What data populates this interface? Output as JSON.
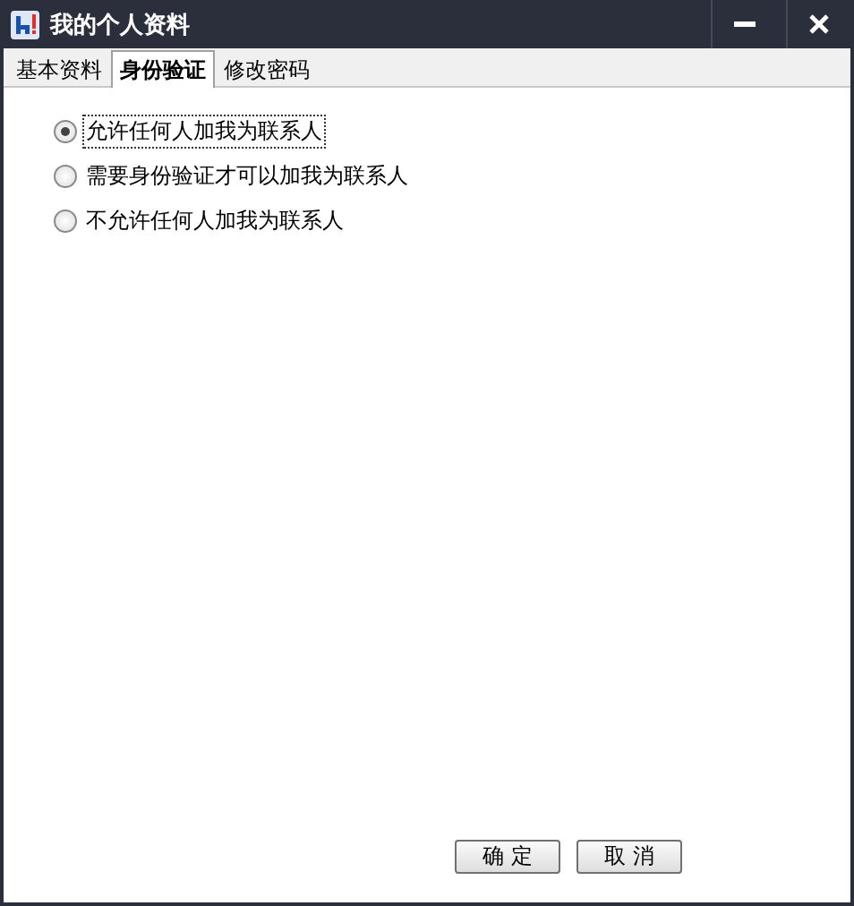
{
  "window": {
    "title": "我的个人资料"
  },
  "tabs": [
    {
      "label": "基本资料",
      "selected": false
    },
    {
      "label": "身份验证",
      "selected": true
    },
    {
      "label": "修改密码",
      "selected": false
    }
  ],
  "options": [
    {
      "label": "允许任何人加我为联系人",
      "selected": true
    },
    {
      "label": "需要身份验证才可以加我为联系人",
      "selected": false
    },
    {
      "label": "不允许任何人加我为联系人",
      "selected": false
    }
  ],
  "buttons": [
    "确 定",
    "取 消"
  ]
}
